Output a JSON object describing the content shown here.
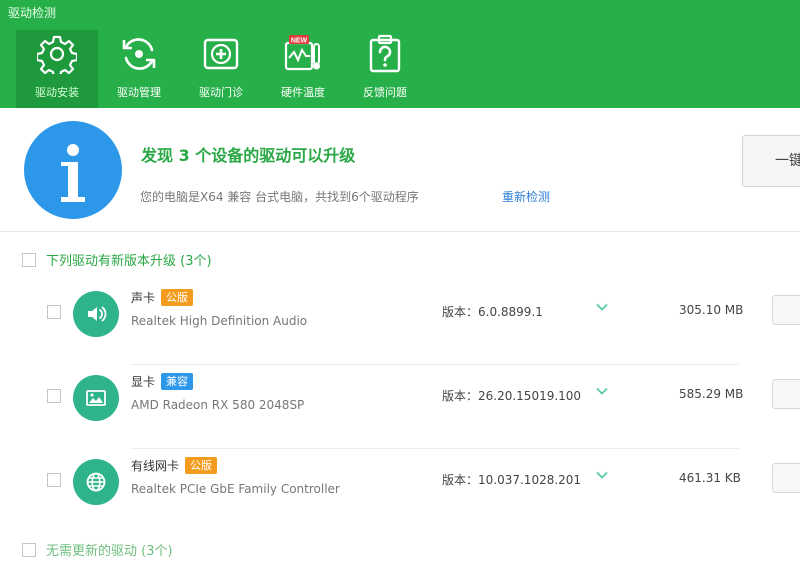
{
  "window": {
    "title": "驱动检测"
  },
  "toolbar": {
    "items": [
      {
        "label": "驱动安装",
        "icon": "gear-icon",
        "active": true
      },
      {
        "label": "驱动管理",
        "icon": "refresh-icon",
        "active": false
      },
      {
        "label": "驱动门诊",
        "icon": "medical-kit-icon",
        "active": false
      },
      {
        "label": "硬件温度",
        "icon": "thermometer-monitor-icon",
        "badge": "NEW",
        "active": false
      },
      {
        "label": "反馈问题",
        "icon": "question-clipboard-icon",
        "active": false
      }
    ]
  },
  "summary": {
    "headline": "发现 3 个设备的驱动可以升级",
    "subline": "您的电脑是X64 兼容 台式电脑，共找到6个驱动程序",
    "rescan": "重新检测",
    "onekey_button": "一键"
  },
  "upgrade_section": {
    "title": "下列驱动有新版本升级 (3个)"
  },
  "drivers": [
    {
      "name": "声卡",
      "tag": "公版",
      "tag_color": "#f39c1e",
      "model": "Realtek High Definition Audio",
      "version": "版本：6.0.8899.1",
      "size": "305.10 MB",
      "icon": "speaker-icon"
    },
    {
      "name": "显卡",
      "tag": "兼容",
      "tag_color": "#2d98ea",
      "model": "AMD Radeon RX 580 2048SP",
      "version": "版本：26.20.15019.100",
      "size": "585.29 MB",
      "icon": "picture-icon"
    },
    {
      "name": "有线网卡",
      "tag": "公版",
      "tag_color": "#f39c1e",
      "model": "Realtek PCIe GbE Family Controller",
      "version": "版本：10.037.1028.201",
      "size": "461.31 KB",
      "icon": "globe-icon"
    }
  ],
  "no_update_section": {
    "title": "无需更新的驱动 (3个)"
  },
  "colors": {
    "brand_green": "#27b04a",
    "active_tab": "#1e9a3c",
    "info_blue": "#2d98ea",
    "driver_icon": "#2fb38a",
    "link_blue": "#2d7fd6"
  }
}
